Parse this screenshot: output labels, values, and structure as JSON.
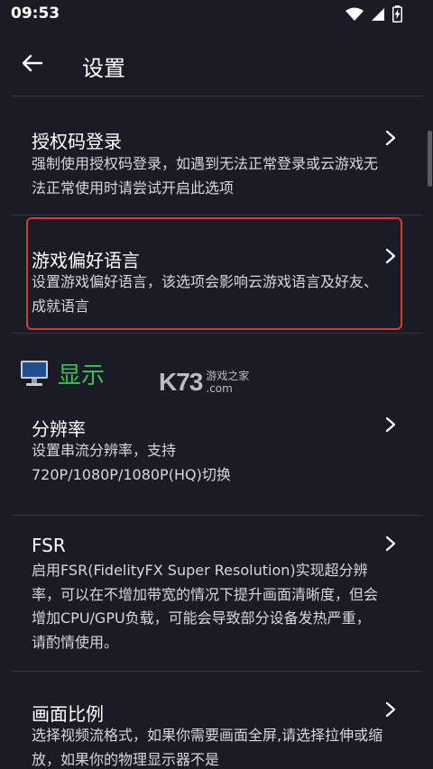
{
  "status": {
    "time": "09:53"
  },
  "header": {
    "title": "设置"
  },
  "items": [
    {
      "title": "授权码登录",
      "desc": "强制使用授权码登录，如遇到无法正常登录或云游戏无法正常使用时请尝试开启此选项"
    },
    {
      "title": "游戏偏好语言",
      "desc": "设置游戏偏好语言，该选项会影响云游戏语言及好友、成就语言"
    }
  ],
  "section": {
    "label": "显示",
    "icon": "monitor-icon"
  },
  "display_items": [
    {
      "title": "分辨率",
      "desc": "设置串流分辨率，支持720P/1080P/1080P(HQ)切换"
    },
    {
      "title": "FSR",
      "desc": "启用FSR(FidelityFX Super Resolution)实现超分辨率，可以在不增加带宽的情况下提升画面清晰度，但会增加CPU/GPU负载，可能会导致部分设备发热严重，请酌情使用。"
    },
    {
      "title": "画面比例",
      "desc": "选择视频流格式，如果你需要画面全屏,请选择拉伸或缩放，如果你的物理显示器不是"
    }
  ],
  "watermark": {
    "logo": "K73",
    "site_cn": "游戏之家",
    "site_en": ".com"
  },
  "colors": {
    "background": "#1a1c25",
    "section_accent": "#3fbf57",
    "highlight": "#e2352b"
  }
}
